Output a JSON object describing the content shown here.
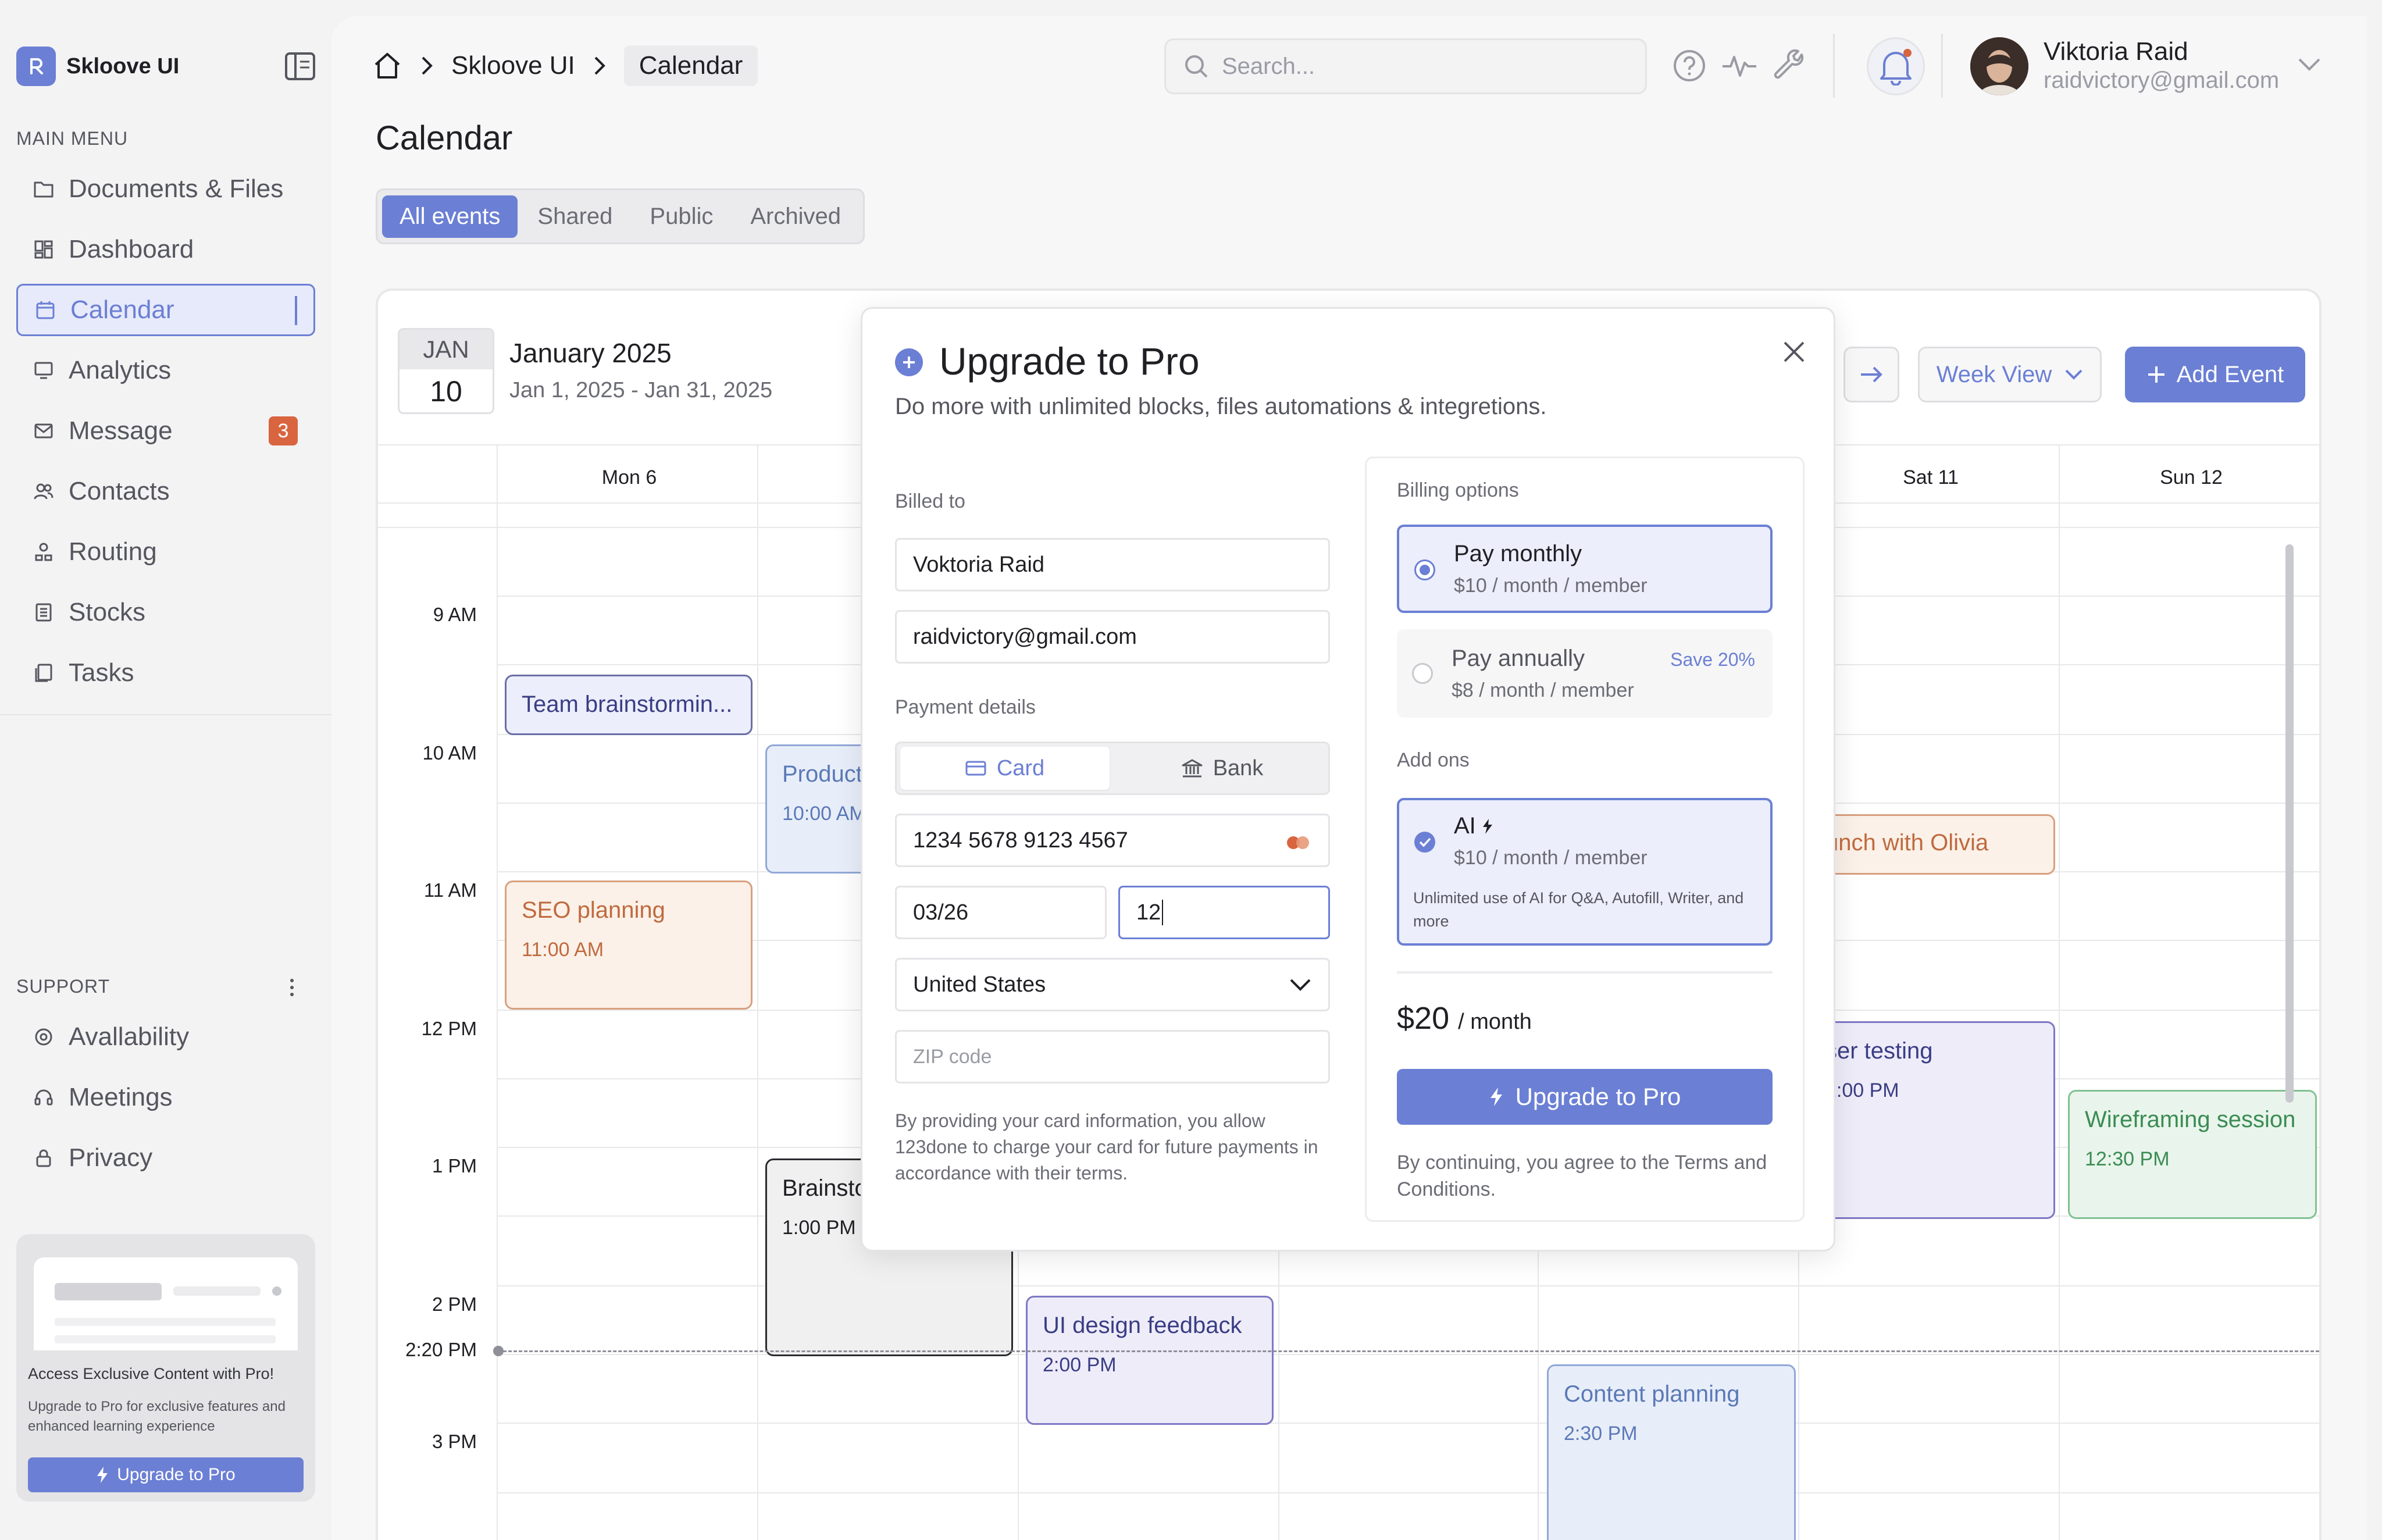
{
  "app": {
    "name": "Skloove UI"
  },
  "sidebar": {
    "main_menu_title": "MAIN MENU",
    "items": [
      {
        "label": "Documents  & Files",
        "icon": "folder-icon"
      },
      {
        "label": "Dashboard",
        "icon": "dashboard-icon"
      },
      {
        "label": "Calendar",
        "icon": "calendar-icon",
        "active": true
      },
      {
        "label": "Analytics",
        "icon": "analytics-icon"
      },
      {
        "label": "Message",
        "icon": "mail-icon",
        "badge": "3"
      },
      {
        "label": "Contacts",
        "icon": "contacts-icon"
      },
      {
        "label": "Routing",
        "icon": "routing-icon"
      },
      {
        "label": "Stocks",
        "icon": "stocks-icon"
      },
      {
        "label": "Tasks",
        "icon": "tasks-icon"
      }
    ],
    "support_title": "SUPPORT",
    "support_items": [
      {
        "label": "Avallability",
        "icon": "availability-icon"
      },
      {
        "label": "Meetings",
        "icon": "headset-icon"
      },
      {
        "label": "Privacy",
        "icon": "lock-icon"
      }
    ],
    "promo": {
      "title": "Access Exclusive Content with Pro!",
      "subtitle": "Upgrade to Pro for exclusive features and enhanced learning experience",
      "button": "Upgrade to Pro"
    }
  },
  "header": {
    "breadcrumb": [
      "Skloove UI",
      "Calendar"
    ],
    "search_placeholder": "Search...",
    "user": {
      "name": "Viktoria Raid",
      "email": "raidvictory@gmail.com"
    }
  },
  "page": {
    "title": "Calendar",
    "tabs": [
      {
        "label": "All events",
        "active": true
      },
      {
        "label": "Shared"
      },
      {
        "label": "Public"
      },
      {
        "label": "Archived"
      }
    ]
  },
  "calendar": {
    "badge_month": "JAN",
    "badge_day": "10",
    "month_title": "January 2025",
    "range": "Jan 1, 2025 - Jan 31, 2025",
    "view": "Week View",
    "add_event": "Add Event",
    "days": [
      "Mon 6",
      "Sat 11",
      "Sun 12"
    ],
    "times": [
      "9 AM",
      "10 AM",
      "11 AM",
      "12 PM",
      "1 PM",
      "2 PM",
      "2:20 PM",
      "3 PM"
    ],
    "events": [
      {
        "title": "Team brainstormin...",
        "time": ""
      },
      {
        "title": "Product",
        "time": "10:00 AM"
      },
      {
        "title": "SEO planning",
        "time": "11:00 AM"
      },
      {
        "title": "unch with Olivia",
        "time": ""
      },
      {
        "title": "ser testing",
        "time": "2:00 PM"
      },
      {
        "title": "Wireframing session",
        "time": "12:30 PM"
      },
      {
        "title": "Brainsto",
        "time": "1:00 PM"
      },
      {
        "title": "UI design feedback",
        "time": "2:00 PM"
      },
      {
        "title": "Content planning",
        "time": "2:30 PM"
      }
    ]
  },
  "modal": {
    "title": "Upgrade to Pro",
    "subtitle": "Do more with unlimited blocks, files automations & integretions.",
    "billed_to_label": "Billed to",
    "name_value": "Voktoria Raid",
    "email_value": "raidvictory@gmail.com",
    "payment_label": "Payment details",
    "tab_card": "Card",
    "tab_bank": "Bank",
    "card_number": "1234 5678 9123 4567",
    "expiry": "03/26",
    "cvc": "12",
    "country": "United States",
    "zip_placeholder": "ZIP code",
    "disclaimer": "By providing your card information, you allow 123done to charge your card for future payments in accordance with their terms.",
    "billing_label": "Billing options",
    "monthly_title": "Pay monthly",
    "monthly_price": "$10 / month / member",
    "annual_title": "Pay annually",
    "annual_price": "$8 / month / member",
    "annual_save": "Save 20%",
    "addons_label": "Add ons",
    "ai_title": "AI",
    "ai_price": "$10 / month / member",
    "ai_desc": "Unlimited use of AI for Q&A, Autofill, Writer, and more",
    "total_amount": "$20",
    "total_period": "/ month",
    "cta": "Upgrade to Pro",
    "terms": "By continuing, you agree to the Terms and Conditions."
  },
  "colors": {
    "accent": "#6b7fd4",
    "badge": "#d8653f"
  }
}
